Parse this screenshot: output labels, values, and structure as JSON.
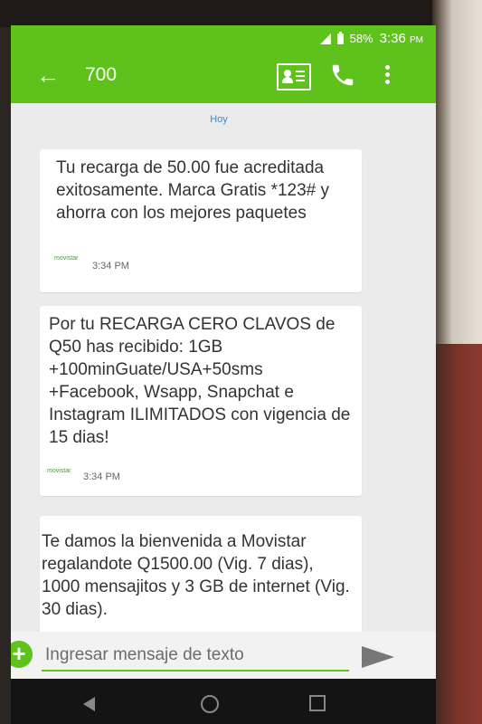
{
  "status_bar": {
    "battery": "58%",
    "time": "3:36",
    "time_suffix": "PM"
  },
  "header": {
    "back_icon": "arrow-left-icon",
    "title": "700"
  },
  "date_separator": "Hoy",
  "messages": [
    {
      "text": "Tu recarga de 50.00 fue acreditada exitosamente. Marca Gratis *123# y ahorra con los mejores paquetes",
      "sender": "movistar",
      "time": "3:34 PM"
    },
    {
      "text": "Por tu RECARGA CERO CLAVOS de Q50 has recibido: 1GB +100minGuate/USA+50sms +Facebook, Wsapp, Snapchat e Instagram ILIMITADOS con vigencia de 15 dias!",
      "sender": "movistar",
      "time": "3:34 PM"
    },
    {
      "text": "Te damos la bienvenida a Movistar regalandote Q1500.00 (Vig. 7 dias), 1000 mensajitos y 3 GB de internet (Vig. 30 dias).",
      "sender": "",
      "time": ""
    }
  ],
  "composer": {
    "placeholder": "Ingresar mensaje de texto",
    "value": ""
  },
  "colors": {
    "accent": "#5fc21c",
    "date": "#3a89c9"
  }
}
